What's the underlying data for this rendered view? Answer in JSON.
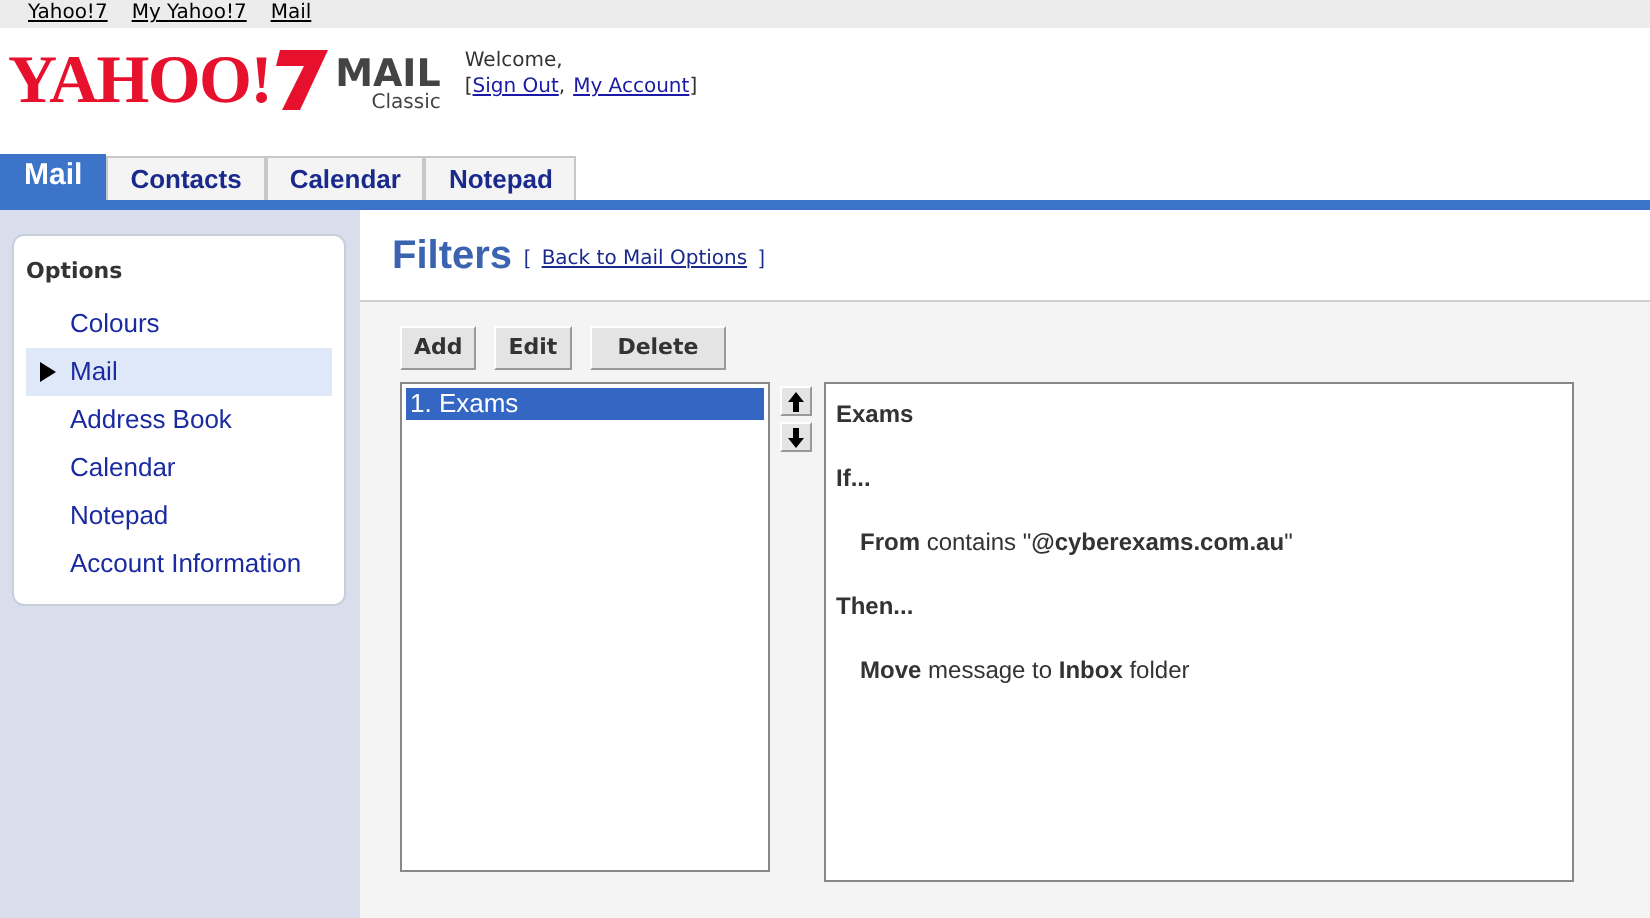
{
  "top_links": [
    "Yahoo!7",
    "My Yahoo!7",
    "Mail"
  ],
  "logo": {
    "brand": "YAHOO!",
    "product": "MAIL",
    "edition": "Classic"
  },
  "welcome": {
    "greeting": "Welcome,",
    "open": "[",
    "links": [
      "Sign Out",
      "My Account"
    ],
    "separator": ",",
    "close": "]"
  },
  "tabs": [
    {
      "label": "Mail",
      "selected": true
    },
    {
      "label": "Contacts",
      "selected": false
    },
    {
      "label": "Calendar",
      "selected": false
    },
    {
      "label": "Notepad",
      "selected": false
    }
  ],
  "sidebar": {
    "heading": "Options",
    "items": [
      {
        "label": "Colours",
        "selected": false
      },
      {
        "label": "Mail",
        "selected": true
      },
      {
        "label": "Address Book",
        "selected": false
      },
      {
        "label": "Calendar",
        "selected": false
      },
      {
        "label": "Notepad",
        "selected": false
      },
      {
        "label": "Account Information",
        "selected": false
      }
    ]
  },
  "page": {
    "title": "Filters",
    "back_open": "[",
    "back_link": "Back to Mail Options",
    "back_close": "]"
  },
  "buttons": [
    "Add",
    "Edit",
    "Delete"
  ],
  "filters": [
    {
      "label": "1. Exams",
      "selected": true
    }
  ],
  "detail": {
    "name": "Exams",
    "if_label": "If...",
    "condition": "**From** contains \"**@cyberexams.com.au**\"",
    "then_label": "Then...",
    "action": "**Move** message to **Inbox** folder"
  }
}
